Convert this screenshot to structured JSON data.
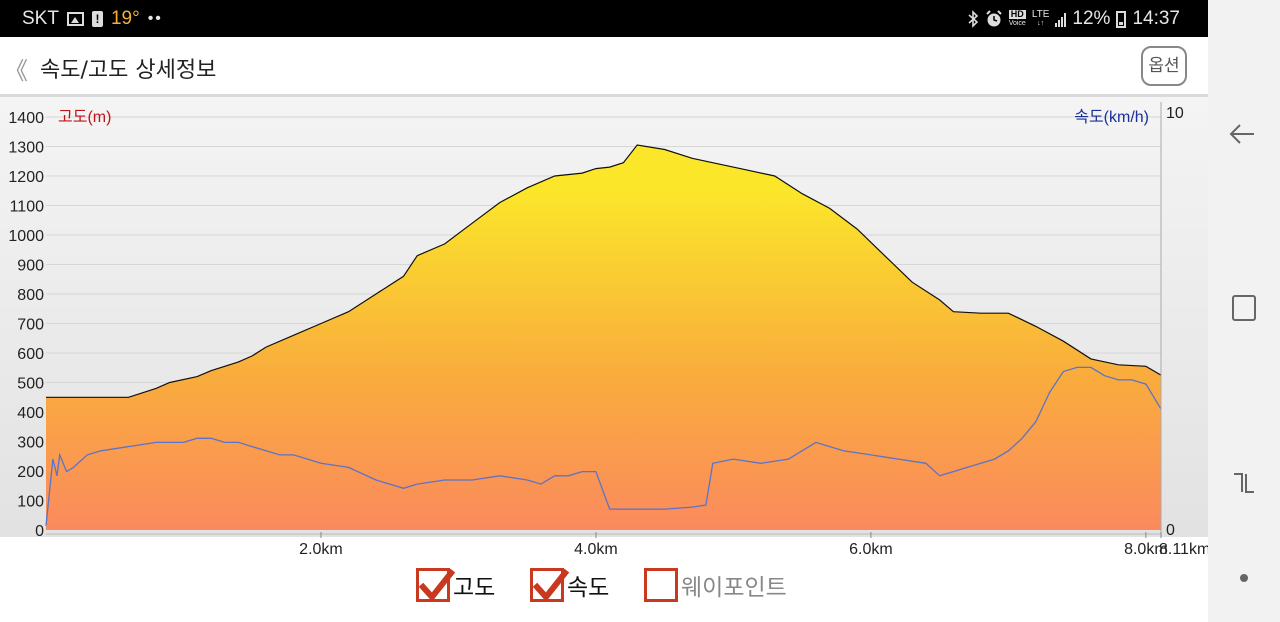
{
  "status_bar": {
    "carrier": "SKT",
    "temperature": "19°",
    "dots": "••",
    "hd_top": "HD",
    "hd_bottom": "Voice",
    "lte_top": "LTE",
    "lte_bottom": "↓↑",
    "battery_percent": "12%",
    "time": "14:37"
  },
  "header": {
    "back_glyph": "《",
    "title": "속도/고도 상세정보",
    "options_label": "옵션"
  },
  "chart_data": {
    "type": "area",
    "ylabel_left": "고도(m)",
    "ylabel_right": "속도(km/h)",
    "y_left_ticks": [
      "1400",
      "1300",
      "1200",
      "1100",
      "1000",
      "900",
      "800",
      "700",
      "600",
      "500",
      "400",
      "300",
      "200",
      "100",
      "0"
    ],
    "y_left_lim": [
      0,
      1400
    ],
    "y_right_ticks": [
      "10",
      "0"
    ],
    "y_right_lim": [
      0,
      10
    ],
    "x_ticks": [
      "2.0km",
      "4.0km",
      "6.0km",
      "8.0km",
      "8.11km"
    ],
    "x_tick_values": [
      2.0,
      4.0,
      6.0,
      8.0,
      8.11
    ],
    "xlim": [
      0,
      8.11
    ],
    "grid": true,
    "series": [
      {
        "name": "고도",
        "x": [
          0.0,
          0.1,
          0.6,
          0.8,
          0.9,
          1.1,
          1.2,
          1.4,
          1.5,
          1.6,
          1.8,
          2.0,
          2.2,
          2.4,
          2.6,
          2.7,
          2.9,
          3.1,
          3.3,
          3.5,
          3.7,
          3.9,
          4.0,
          4.1,
          4.2,
          4.3,
          4.5,
          4.7,
          4.9,
          5.1,
          5.3,
          5.5,
          5.7,
          5.9,
          6.1,
          6.3,
          6.5,
          6.6,
          6.8,
          7.0,
          7.2,
          7.4,
          7.6,
          7.8,
          8.0,
          8.11
        ],
        "values": [
          450,
          450,
          450,
          480,
          500,
          520,
          540,
          570,
          590,
          620,
          660,
          700,
          740,
          800,
          860,
          930,
          970,
          1040,
          1110,
          1160,
          1200,
          1210,
          1225,
          1230,
          1245,
          1305,
          1290,
          1260,
          1240,
          1220,
          1200,
          1140,
          1090,
          1020,
          930,
          840,
          780,
          740,
          735,
          735,
          690,
          640,
          580,
          560,
          555,
          525
        ]
      },
      {
        "name": "속도",
        "x": [
          0.0,
          0.05,
          0.08,
          0.1,
          0.15,
          0.2,
          0.3,
          0.4,
          0.6,
          0.8,
          1.0,
          1.1,
          1.2,
          1.3,
          1.4,
          1.5,
          1.6,
          1.7,
          1.8,
          2.0,
          2.2,
          2.4,
          2.6,
          2.7,
          2.9,
          3.1,
          3.3,
          3.5,
          3.6,
          3.7,
          3.8,
          3.9,
          4.0,
          4.1,
          4.3,
          4.5,
          4.7,
          4.8,
          4.85,
          5.0,
          5.2,
          5.4,
          5.6,
          5.8,
          6.0,
          6.2,
          6.4,
          6.5,
          6.6,
          6.7,
          6.8,
          6.9,
          7.0,
          7.1,
          7.2,
          7.3,
          7.4,
          7.5,
          7.6,
          7.7,
          7.8,
          7.9,
          8.0,
          8.11
        ],
        "values": [
          0.1,
          1.7,
          1.3,
          1.8,
          1.4,
          1.5,
          1.8,
          1.9,
          2.0,
          2.1,
          2.1,
          2.2,
          2.2,
          2.1,
          2.1,
          2.0,
          1.9,
          1.8,
          1.8,
          1.6,
          1.5,
          1.2,
          1.0,
          1.1,
          1.2,
          1.2,
          1.3,
          1.2,
          1.1,
          1.3,
          1.3,
          1.4,
          1.4,
          0.5,
          0.5,
          0.5,
          0.55,
          0.6,
          1.6,
          1.7,
          1.6,
          1.7,
          2.1,
          1.9,
          1.8,
          1.7,
          1.6,
          1.3,
          1.4,
          1.5,
          1.6,
          1.7,
          1.9,
          2.2,
          2.6,
          3.3,
          3.8,
          3.9,
          3.9,
          3.7,
          3.6,
          3.6,
          3.5,
          2.9
        ]
      }
    ],
    "colors": {
      "area_top": "#fbe62a",
      "area_mid": "#f9ac3d",
      "area_bottom": "#fb8a5e",
      "altitude_line": "#111111",
      "speed_line": "#5b73c8",
      "left_axis_label": "#c0141c",
      "right_axis_label": "#1b2f9a"
    }
  },
  "legend": {
    "items": [
      {
        "label": "고도",
        "checked": true
      },
      {
        "label": "속도",
        "checked": true
      },
      {
        "label": "웨이포인트",
        "checked": false
      }
    ]
  }
}
